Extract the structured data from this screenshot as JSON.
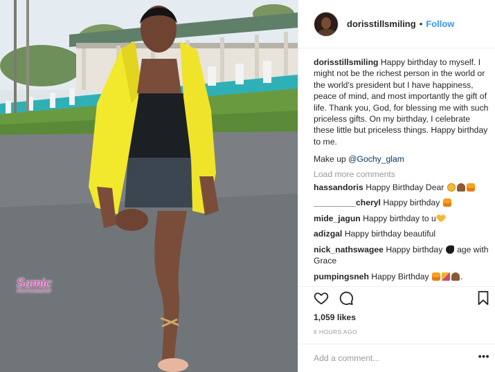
{
  "photo": {
    "alt": "Woman in yellow coat standing on a road",
    "watermark": "Samic",
    "watermark_sub": "PHOTOGRAPHY"
  },
  "post": {
    "author": "dorisstillsmiling",
    "separator": "•",
    "follow_label": "Follow",
    "caption_user": "dorisstillsmiling",
    "caption_text": "Happy birthday to myself. I might not be the richest person in the world or the world's president but I have happiness, peace of mind, and most importantly the gift of life. Thank you, God, for blessing me with such priceless gifts. On my birthday, I celebrate these little but priceless things. Happy birthday to me.",
    "makeup_prefix": "Make up ",
    "makeup_mention": "@Gochy_glam",
    "load_more": "Load more comments",
    "likes": "1,059 likes",
    "time": "6 HOURS AGO",
    "comment_placeholder": "Add a comment...",
    "more_options": "•••"
  },
  "comments": [
    {
      "user": "hassandoris",
      "text": "Happy Birthday Dear",
      "emojis": [
        "face",
        "cake",
        "gift"
      ]
    },
    {
      "user": "_________cheryl",
      "text": "Happy birthday",
      "emojis": [
        "gift"
      ]
    },
    {
      "user": "mide_jagun",
      "text": "Happy birthday to u",
      "emojis": [
        "heart"
      ]
    },
    {
      "user": "adizgal",
      "text": "Happy birthday beautiful",
      "emojis": []
    },
    {
      "user": "nick_nathswagee",
      "text": "Happy birthday",
      "text_after": " age with Grace",
      "emojis": [
        "bird"
      ]
    },
    {
      "user": "pumpingsneh",
      "text": "Happy Birthday",
      "text_after": ".",
      "emojis": [
        "gift",
        "party",
        "cake"
      ]
    }
  ],
  "icons": {
    "like": "heart-icon",
    "comment": "speech-bubble-icon",
    "save": "bookmark-icon"
  },
  "colors": {
    "link": "#3897f0",
    "mention": "#003569",
    "muted": "#999999",
    "coat": "#f2e82c"
  }
}
